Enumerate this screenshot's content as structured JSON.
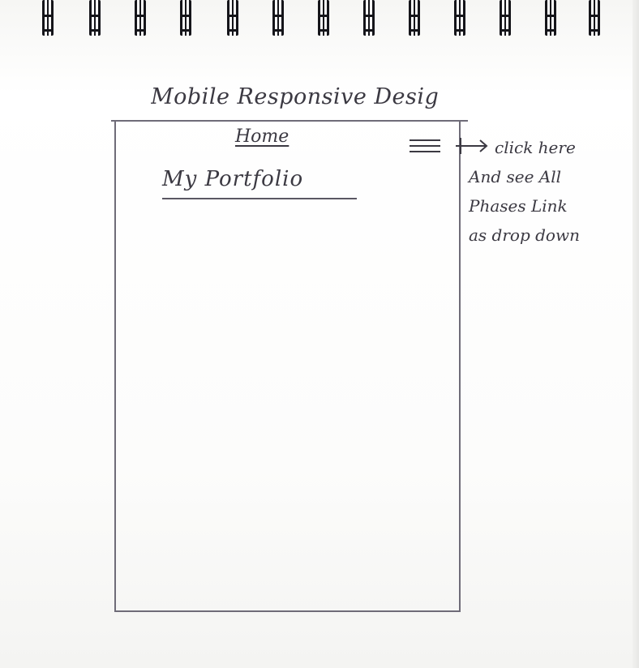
{
  "sketch": {
    "title": "Mobile Responsive Desig",
    "nav_home": "Home",
    "brand": "My Portfolio",
    "menu_icon": "hamburger-icon",
    "annotation": [
      "click here",
      "And see All",
      "Phases Link",
      "as drop down"
    ]
  }
}
